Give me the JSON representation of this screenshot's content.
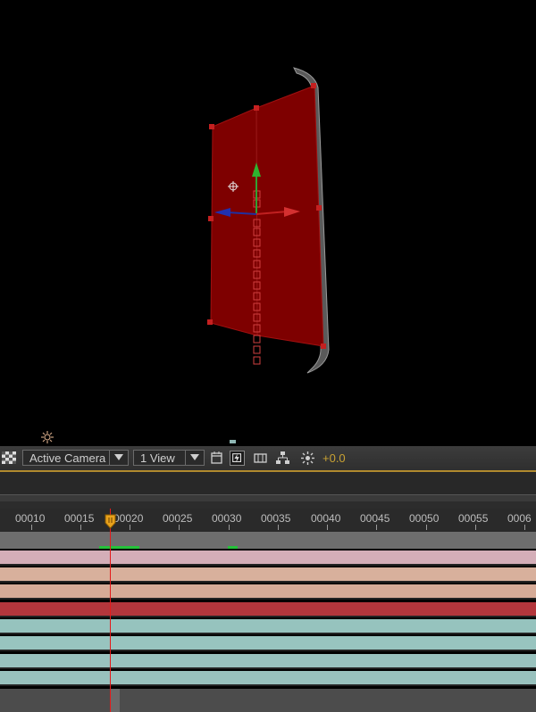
{
  "toolbar": {
    "camera_label": "Active Camera",
    "views_label": "1 View",
    "exposure_value": "+0.0"
  },
  "timeline": {
    "ruler_labels": [
      "00010",
      "00015",
      "00020",
      "00025",
      "00030",
      "00035",
      "00040",
      "00045",
      "00050",
      "00055",
      "0006"
    ],
    "current_frame_indicator": "playhead"
  },
  "layers": [
    {
      "color": "#d4aeb8"
    },
    {
      "color": "#d8b09c"
    },
    {
      "color": "#d6ab97"
    },
    {
      "color": "#b3363c"
    },
    {
      "color": "#96c3be"
    },
    {
      "color": "#98c4bf"
    },
    {
      "color": "#99c2be"
    },
    {
      "color": "#98c1bd"
    }
  ],
  "colors": {
    "layer_fill": "#8b0000",
    "accent_orange": "#c9a233",
    "playhead": "#e51a1a",
    "work_marker": "#25c23a"
  },
  "icons": [
    "grid-toggle-icon",
    "chevron-down-icon",
    "calendar-icon",
    "fast-preview-icon",
    "3d-view-icon",
    "flowchart-icon",
    "exposure-icon",
    "light-icon",
    "camera-poi-icon"
  ]
}
